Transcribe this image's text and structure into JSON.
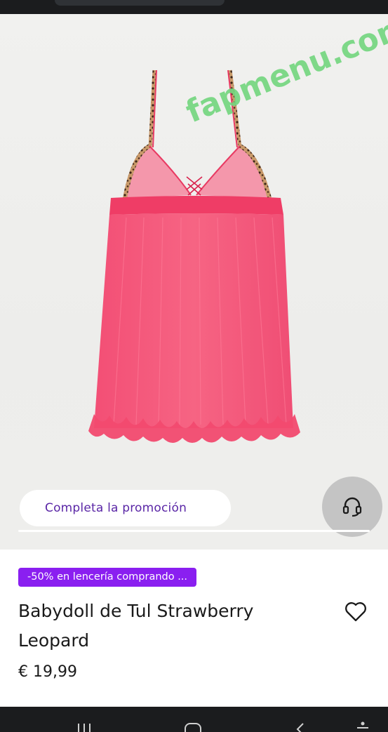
{
  "watermark": {
    "text": "fapmenu.com"
  },
  "promo": {
    "label": "Completa la promoción"
  },
  "support": {
    "icon": "headset-icon"
  },
  "product": {
    "badge": "-50% en lencería comprando ...",
    "title": "Babydoll de Tul Strawberry Leopard",
    "price": "€ 19,99",
    "favorite_icon": "heart-outline-icon",
    "image_progress": 1.0
  },
  "colors": {
    "accent": "#8a1ff0",
    "promo_text": "#5a26a6",
    "garment": "#f0456a",
    "watermark": "#72d67e"
  },
  "system_nav": {
    "icons": [
      "recent-apps-icon",
      "home-icon",
      "back-icon",
      "accessibility-icon"
    ]
  }
}
